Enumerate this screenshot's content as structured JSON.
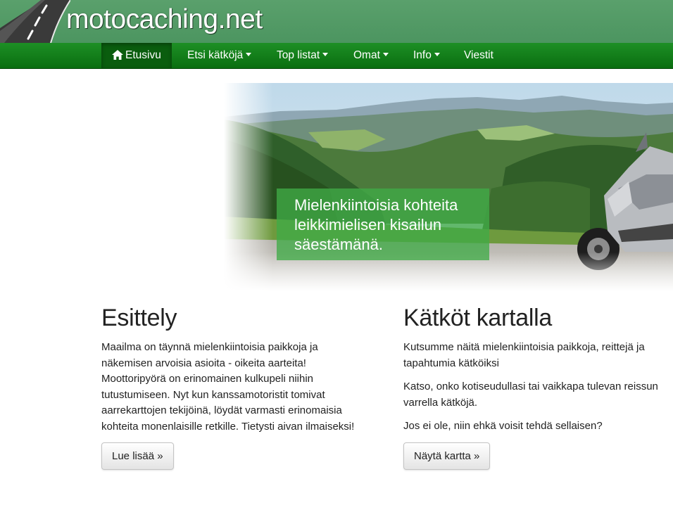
{
  "site": {
    "title": "motocaching.net"
  },
  "nav": {
    "home": "Etusivu",
    "find": "Etsi kätköjä",
    "top_lists": "Top listat",
    "own": "Omat",
    "info": "Info",
    "messages": "Viestit"
  },
  "hero": {
    "caption_lines": [
      "Mielenkiintoisia kohteita",
      "leikkimielisen kisailun",
      "säestämänä."
    ]
  },
  "intro": {
    "heading": "Esittely",
    "lines": [
      "Maailma on täynnä mielenkiintoisia paikkoja ja",
      "näkemisen arvoisia asioita - oikeita aarteita!",
      "Moottoripyörä on erinomainen kulkupeli niihin",
      "tutustumiseen. Nyt kun kanssamotoristit tomivat",
      "aarrekarttojen tekijöinä, löydät varmasti erinomaisia",
      "kohteita monenlaisille retkille. Tietysti aivan ilmaiseksi!"
    ],
    "button": "Lue lisää »"
  },
  "map": {
    "heading": "Kätköt kartalla",
    "p1_lines": [
      "Kutsumme näitä mielenkiintoisia paikkoja, reittejä ja",
      "tapahtumia kätköiksi"
    ],
    "p2_lines": [
      "Katso, onko kotiseudullasi tai vaikkapa tulevan reissun",
      "varrella kätköjä."
    ],
    "p3": "Jos ei ole, niin ehkä voisit tehdä sellaisen?",
    "button": "Näytä kartta »"
  },
  "colors": {
    "brand_bar": "#4f9863",
    "nav_bar": "#127e18",
    "nav_active": "#0a5d0e",
    "caption_bg": "#40aa46"
  },
  "icons": {
    "home": "home-icon",
    "logo": "road-logo-icon"
  }
}
